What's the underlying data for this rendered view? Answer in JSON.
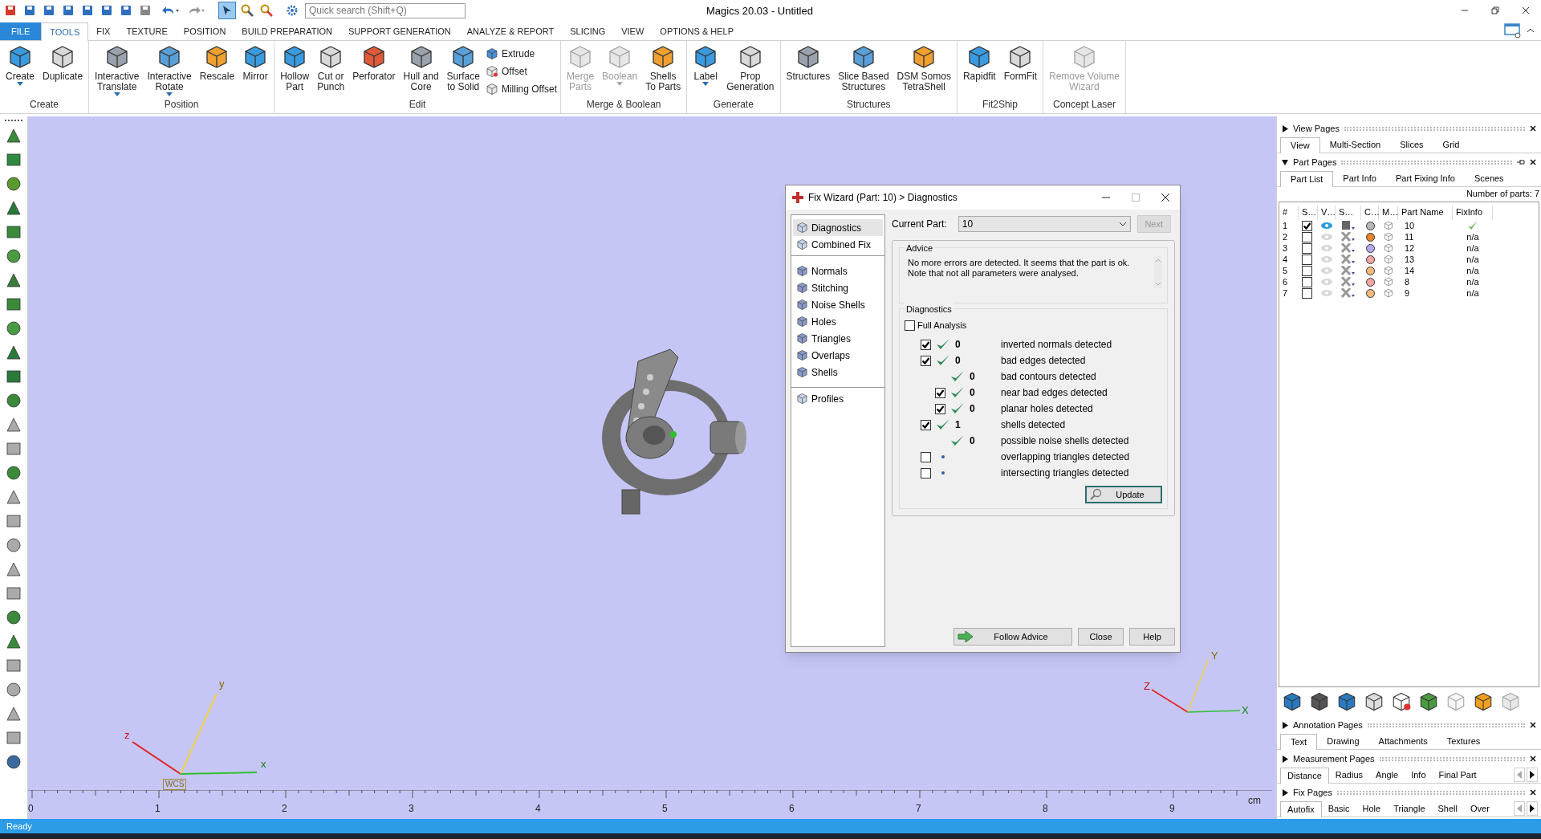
{
  "window": {
    "title": "Magics 20.03 - Untitled"
  },
  "quick_search": {
    "placeholder": "Quick search (Shift+Q)"
  },
  "ribbon_tabs": [
    {
      "label": "FILE",
      "kind": "file",
      "selected": false
    },
    {
      "label": "TOOLS",
      "kind": "tab",
      "selected": true
    },
    {
      "label": "FIX",
      "kind": "tab",
      "selected": false
    },
    {
      "label": "TEXTURE",
      "kind": "tab",
      "selected": false
    },
    {
      "label": "POSITION",
      "kind": "tab",
      "selected": false
    },
    {
      "label": "BUILD PREPARATION",
      "kind": "tab",
      "selected": false
    },
    {
      "label": "SUPPORT GENERATION",
      "kind": "tab",
      "selected": false
    },
    {
      "label": "ANALYZE & REPORT",
      "kind": "tab",
      "selected": false
    },
    {
      "label": "SLICING",
      "kind": "tab",
      "selected": false
    },
    {
      "label": "VIEW",
      "kind": "tab",
      "selected": false
    },
    {
      "label": "OPTIONS & HELP",
      "kind": "tab",
      "selected": false
    }
  ],
  "ribbon_groups": [
    {
      "label": "Create",
      "tools": [
        {
          "kind": "large",
          "lines": [
            "Create"
          ],
          "dropdown": true,
          "disabled": false
        },
        {
          "kind": "large",
          "lines": [
            "Duplicate"
          ],
          "dropdown": false,
          "disabled": false
        }
      ]
    },
    {
      "label": "Position",
      "tools": [
        {
          "kind": "large",
          "lines": [
            "Interactive",
            "Translate"
          ],
          "dropdown": true,
          "disabled": false
        },
        {
          "kind": "large",
          "lines": [
            "Interactive",
            "Rotate"
          ],
          "dropdown": true,
          "disabled": false
        },
        {
          "kind": "large",
          "lines": [
            "Rescale"
          ],
          "dropdown": false,
          "disabled": false
        },
        {
          "kind": "large",
          "lines": [
            "Mirror"
          ],
          "dropdown": false,
          "disabled": false
        }
      ]
    },
    {
      "label": "Edit",
      "tools": [
        {
          "kind": "large",
          "lines": [
            "Hollow",
            "Part"
          ],
          "dropdown": false,
          "disabled": false
        },
        {
          "kind": "large",
          "lines": [
            "Cut or",
            "Punch"
          ],
          "dropdown": false,
          "disabled": false
        },
        {
          "kind": "large",
          "lines": [
            "Perforator"
          ],
          "dropdown": false,
          "disabled": false
        },
        {
          "kind": "large",
          "lines": [
            "Hull and",
            "Core"
          ],
          "dropdown": false,
          "disabled": false
        },
        {
          "kind": "large",
          "lines": [
            "Surface",
            "to Solid"
          ],
          "dropdown": false,
          "disabled": false
        },
        {
          "kind": "stack",
          "items": [
            {
              "label": "Extrude"
            },
            {
              "label": "Offset"
            },
            {
              "label": "Milling Offset"
            }
          ]
        }
      ]
    },
    {
      "label": "Merge & Boolean",
      "tools": [
        {
          "kind": "large",
          "lines": [
            "Merge",
            "Parts"
          ],
          "dropdown": false,
          "disabled": true
        },
        {
          "kind": "large",
          "lines": [
            "Boolean"
          ],
          "dropdown": true,
          "disabled": true
        },
        {
          "kind": "large",
          "lines": [
            "Shells",
            "To Parts"
          ],
          "dropdown": false,
          "disabled": false
        }
      ]
    },
    {
      "label": "Generate",
      "tools": [
        {
          "kind": "large",
          "lines": [
            "Label"
          ],
          "dropdown": true,
          "disabled": false
        },
        {
          "kind": "large",
          "lines": [
            "Prop",
            "Generation"
          ],
          "dropdown": false,
          "disabled": false
        }
      ]
    },
    {
      "label": "Structures",
      "tools": [
        {
          "kind": "large",
          "lines": [
            "Structures"
          ],
          "dropdown": false,
          "disabled": false
        },
        {
          "kind": "large",
          "lines": [
            "Slice Based",
            "Structures"
          ],
          "dropdown": false,
          "disabled": false
        },
        {
          "kind": "large",
          "lines": [
            "DSM Somos",
            "TetraShell"
          ],
          "dropdown": false,
          "disabled": false
        }
      ]
    },
    {
      "label": "Fit2Ship",
      "tools": [
        {
          "kind": "large",
          "lines": [
            "Rapidfit"
          ],
          "dropdown": false,
          "disabled": false
        },
        {
          "kind": "large",
          "lines": [
            "FormFit"
          ],
          "dropdown": false,
          "disabled": false
        }
      ]
    },
    {
      "label": "Concept Laser",
      "tools": [
        {
          "kind": "large",
          "lines": [
            "Remove Volume",
            "Wizard"
          ],
          "dropdown": false,
          "disabled": true
        }
      ]
    }
  ],
  "viewport": {
    "triads": [
      {
        "x": "x",
        "y": "y",
        "z": "z",
        "tag": "WCS"
      },
      {
        "x": "X",
        "y": "Y",
        "z": "Z"
      }
    ],
    "ruler": {
      "ticks": [
        "0",
        "1",
        "2",
        "3",
        "4",
        "5",
        "6",
        "7",
        "8",
        "9"
      ],
      "unit": "cm"
    }
  },
  "fix_wizard": {
    "title": "Fix Wizard (Part: 10) > Diagnostics",
    "nav_groups": [
      {
        "items": [
          {
            "label": "Diagnostics",
            "selected": true
          },
          {
            "label": "Combined Fix",
            "selected": false
          }
        ]
      },
      {
        "items": [
          {
            "label": "Normals",
            "selected": false
          },
          {
            "label": "Stitching",
            "selected": false
          },
          {
            "label": "Noise Shells",
            "selected": false
          },
          {
            "label": "Holes",
            "selected": false
          },
          {
            "label": "Triangles",
            "selected": false
          },
          {
            "label": "Overlaps",
            "selected": false
          },
          {
            "label": "Shells",
            "selected": false
          }
        ]
      },
      {
        "items": [
          {
            "label": "Profiles",
            "selected": false
          }
        ]
      }
    ],
    "current_part_label": "Current Part:",
    "current_part": "10",
    "next_button": {
      "label": "Next",
      "disabled": true
    },
    "advice": {
      "title": "Advice",
      "lines": [
        "No more errors are detected. It seems that the part is ok.",
        "Note that not all parameters were analysed."
      ]
    },
    "diagnostics": {
      "title": "Diagnostics",
      "full_analysis": {
        "label": "Full Analysis",
        "checked": false
      },
      "rows": [
        {
          "kind": "checkbox",
          "checked": true,
          "analysed": true,
          "count": "0",
          "label": "inverted normals detected"
        },
        {
          "kind": "checkbox",
          "checked": true,
          "analysed": true,
          "count": "0",
          "label": "bad edges detected",
          "children": [
            {
              "kind": "plain",
              "analysed": true,
              "count": "0",
              "label": "bad contours detected"
            },
            {
              "kind": "checkbox",
              "checked": true,
              "analysed": true,
              "count": "0",
              "label": "near bad edges detected"
            },
            {
              "kind": "checkbox",
              "checked": true,
              "analysed": true,
              "count": "0",
              "label": "planar holes detected"
            }
          ]
        },
        {
          "kind": "checkbox",
          "checked": true,
          "analysed": true,
          "count": "1",
          "label": "shells detected",
          "children": [
            {
              "kind": "plain",
              "analysed": true,
              "count": "0",
              "label": "possible noise shells detected"
            }
          ]
        },
        {
          "kind": "checkbox",
          "checked": false,
          "analysed": false,
          "label": "overlapping triangles detected"
        },
        {
          "kind": "checkbox",
          "checked": false,
          "analysed": false,
          "label": "intersecting triangles detected"
        }
      ],
      "update_button": "Update"
    },
    "buttons": [
      "Follow Advice",
      "Close",
      "Help"
    ]
  },
  "side_panels": [
    {
      "title": "View Pages",
      "expanded": false,
      "pinnable": false,
      "scrollable": false,
      "tabs": [
        {
          "label": "View",
          "selected": true
        },
        {
          "label": "Multi-Section",
          "selected": false
        },
        {
          "label": "Slices",
          "selected": false
        },
        {
          "label": "Grid",
          "selected": false
        }
      ]
    },
    {
      "title": "Part Pages",
      "expanded": true,
      "pinnable": true,
      "scrollable": false,
      "tabs": [
        {
          "label": "Part List",
          "selected": true
        },
        {
          "label": "Part Info",
          "selected": false
        },
        {
          "label": "Part Fixing Info",
          "selected": false
        },
        {
          "label": "Scenes",
          "selected": false
        }
      ],
      "part_list": {
        "count_text": "Number of parts: 7",
        "columns": [
          "#",
          "S…",
          "V…",
          "S…",
          "C…",
          "M…",
          "Part Name",
          "FixInfo"
        ],
        "rows": [
          {
            "num": "1",
            "selected": true,
            "visible": true,
            "color": "#b8b8b8",
            "name": "10",
            "fix_ok": true
          },
          {
            "num": "2",
            "selected": false,
            "visible": false,
            "color": "#e8842c",
            "name": "11",
            "fix_ok": false,
            "fix_info": "n/a"
          },
          {
            "num": "3",
            "selected": false,
            "visible": false,
            "color": "#b4aaea",
            "name": "12",
            "fix_ok": false,
            "fix_info": "n/a"
          },
          {
            "num": "4",
            "selected": false,
            "visible": false,
            "color": "#f2a6a6",
            "name": "13",
            "fix_ok": false,
            "fix_info": "n/a"
          },
          {
            "num": "5",
            "selected": false,
            "visible": false,
            "color": "#f5b980",
            "name": "14",
            "fix_ok": false,
            "fix_info": "n/a"
          },
          {
            "num": "6",
            "selected": false,
            "visible": false,
            "color": "#f2a6a6",
            "name": "8",
            "fix_ok": false,
            "fix_info": "n/a"
          },
          {
            "num": "7",
            "selected": false,
            "visible": false,
            "color": "#f5b980",
            "name": "9",
            "fix_ok": false,
            "fix_info": "n/a"
          }
        ]
      }
    },
    {
      "title": "Annotation Pages",
      "expanded": false,
      "pinnable": false,
      "scrollable": false,
      "tabs": [
        {
          "label": "Text",
          "selected": true
        },
        {
          "label": "Drawing",
          "selected": false
        },
        {
          "label": "Attachments",
          "selected": false
        },
        {
          "label": "Textures",
          "selected": false
        }
      ]
    },
    {
      "title": "Measurement Pages",
      "expanded": false,
      "pinnable": false,
      "scrollable": true,
      "tabs": [
        {
          "label": "Distance",
          "selected": true
        },
        {
          "label": "Radius",
          "selected": false
        },
        {
          "label": "Angle",
          "selected": false
        },
        {
          "label": "Info",
          "selected": false
        },
        {
          "label": "Final Part",
          "selected": false
        }
      ]
    },
    {
      "title": "Fix Pages",
      "expanded": false,
      "pinnable": false,
      "scrollable": true,
      "tabs": [
        {
          "label": "Autofix",
          "selected": true
        },
        {
          "label": "Basic",
          "selected": false
        },
        {
          "label": "Hole",
          "selected": false
        },
        {
          "label": "Triangle",
          "selected": false
        },
        {
          "label": "Shell",
          "selected": false
        },
        {
          "label": "Over",
          "selected": false
        }
      ]
    }
  ],
  "status_bar": {
    "text": "Ready"
  }
}
